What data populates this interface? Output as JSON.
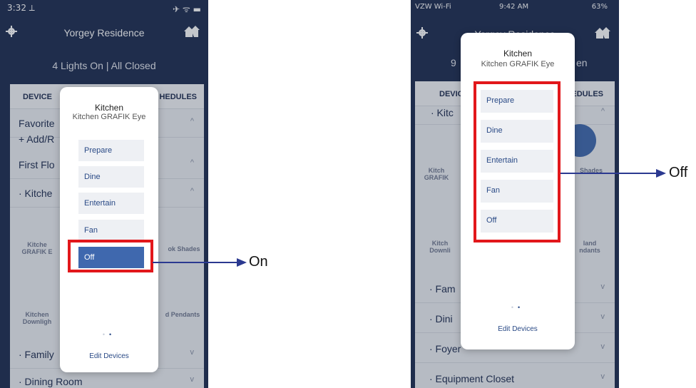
{
  "left": {
    "status": {
      "time": "3:32 ⟂",
      "right_icons": "✈ ᯤ ▬"
    },
    "header": {
      "title": "Yorgey Residence",
      "subtitle": "4 Lights On | All Closed"
    },
    "tabs": {
      "devices": "DEVICE",
      "schedules": "HEDULES"
    },
    "rows": [
      {
        "label": "Favorite",
        "chev": "^"
      },
      {
        "label": "+ Add/R",
        "chev": ""
      },
      {
        "label": "First Flo",
        "chev": "^"
      },
      {
        "label": "· Kitche",
        "chev": "^"
      },
      {
        "label": "· Family",
        "chev": "v"
      },
      {
        "label": "· Dining Room",
        "chev": "v"
      }
    ],
    "tiles": [
      {
        "label": "Kitche\nGRAFIK E"
      },
      {
        "label": "ok Shades"
      },
      {
        "label": "Kitchen\nDownligh"
      },
      {
        "label": "d Pendants"
      }
    ],
    "modal": {
      "title": "Kitchen",
      "subtitle": "Kitchen GRAFIK Eye",
      "scenes": [
        "Prepare",
        "Dine",
        "Entertain",
        "Fan",
        "Off"
      ],
      "active_scene_index": 4,
      "edit": "Edit Devices"
    },
    "annotation": "On"
  },
  "right": {
    "status": {
      "carrier": "VZW Wi-Fi",
      "time": "9:42 AM",
      "battery": "63%"
    },
    "header": {
      "title_partial": "Yorgey Residence",
      "subtitle_left": "9",
      "subtitle_right": "en"
    },
    "tabs": {
      "devices": "DEVIC",
      "schedules": "EDULES"
    },
    "rows": [
      {
        "label": "· Kitc",
        "chev": "^"
      },
      {
        "label": "· Fam",
        "chev": "v"
      },
      {
        "label": "· Dini",
        "chev": "v"
      },
      {
        "label": "· Foyer",
        "chev": "v"
      },
      {
        "label": "· Equipment Closet",
        "chev": "v"
      }
    ],
    "tiles": [
      {
        "label": "Kitch\nGRAFIK"
      },
      {
        "label": "Shades"
      },
      {
        "label": "Kitch\nDownli"
      },
      {
        "label": "land\nndants"
      }
    ],
    "modal": {
      "title": "Kitchen",
      "subtitle": "Kitchen GRAFIK Eye",
      "scenes": [
        "Prepare",
        "Dine",
        "Entertain",
        "Fan",
        "Off"
      ],
      "edit": "Edit Devices"
    },
    "annotation": "Off"
  },
  "colors": {
    "nav_bg": "#1d2b4f",
    "accent": "#3f68ae",
    "highlight": "#e2171b",
    "arrow": "#2b3990"
  }
}
